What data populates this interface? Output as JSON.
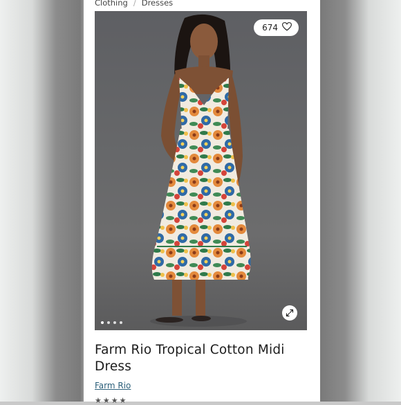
{
  "breadcrumb": {
    "items": [
      "Clothing",
      "Dresses"
    ],
    "separator": "/"
  },
  "product": {
    "like_count": "674",
    "title": "Farm Rio Tropical Cotton Midi Dress",
    "brand": "Farm Rio"
  },
  "carousel": {
    "total": 4,
    "active": 1
  },
  "colors": {
    "hero_bg": "#666769",
    "brand_link": "#2b5f7a"
  },
  "icons": {
    "like": "heart-icon",
    "expand": "expand-icon"
  }
}
